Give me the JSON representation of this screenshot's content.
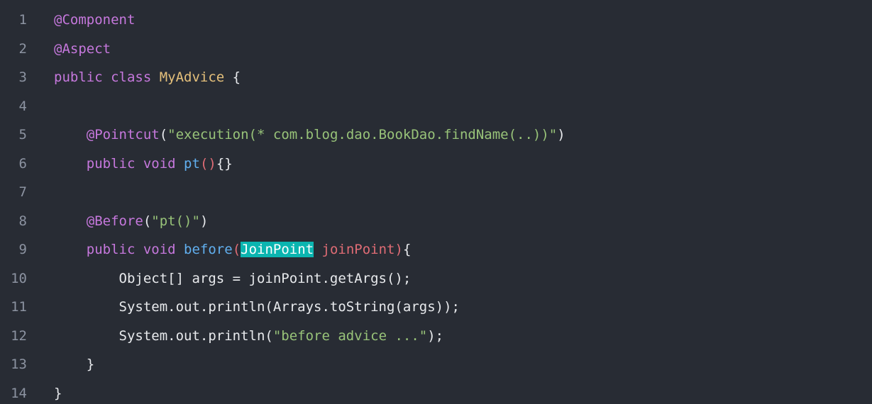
{
  "colors": {
    "background": "#282c34",
    "line_number": "#8c93a1",
    "annotation": "#c678dd",
    "keyword": "#c678dd",
    "class_name": "#e5c07b",
    "plain": "#e8eaed",
    "string": "#98c379",
    "function": "#61afef",
    "param": "#e06c75",
    "highlight_bg": "#0bb5b0"
  },
  "code": {
    "lines": [
      {
        "n": "1",
        "tokens": [
          {
            "t": "@Component",
            "c": "annotation"
          }
        ]
      },
      {
        "n": "2",
        "tokens": [
          {
            "t": "@Aspect",
            "c": "annotation"
          }
        ]
      },
      {
        "n": "3",
        "tokens": [
          {
            "t": "public class ",
            "c": "keyword"
          },
          {
            "t": "MyAdvice",
            "c": "class"
          },
          {
            "t": " {",
            "c": "plain"
          }
        ]
      },
      {
        "n": "4",
        "tokens": []
      },
      {
        "n": "5",
        "tokens": [
          {
            "t": "    ",
            "c": "plain"
          },
          {
            "t": "@Pointcut",
            "c": "annotation"
          },
          {
            "t": "(",
            "c": "plain"
          },
          {
            "t": "\"execution(* com.blog.dao.BookDao.findName(..))\"",
            "c": "string"
          },
          {
            "t": ")",
            "c": "plain"
          }
        ]
      },
      {
        "n": "6",
        "tokens": [
          {
            "t": "    ",
            "c": "plain"
          },
          {
            "t": "public void ",
            "c": "keyword"
          },
          {
            "t": "pt",
            "c": "func"
          },
          {
            "t": "()",
            "c": "param"
          },
          {
            "t": "{}",
            "c": "plain"
          }
        ]
      },
      {
        "n": "7",
        "tokens": []
      },
      {
        "n": "8",
        "tokens": [
          {
            "t": "    ",
            "c": "plain"
          },
          {
            "t": "@Before",
            "c": "annotation"
          },
          {
            "t": "(",
            "c": "plain"
          },
          {
            "t": "\"pt()\"",
            "c": "string"
          },
          {
            "t": ")",
            "c": "plain"
          }
        ]
      },
      {
        "n": "9",
        "tokens": [
          {
            "t": "    ",
            "c": "plain"
          },
          {
            "t": "public void ",
            "c": "keyword"
          },
          {
            "t": "before",
            "c": "func"
          },
          {
            "t": "(",
            "c": "param"
          },
          {
            "t": "JoinPoint",
            "c": "highlight"
          },
          {
            "t": " joinPoint)",
            "c": "param"
          },
          {
            "t": "{",
            "c": "plain"
          }
        ]
      },
      {
        "n": "10",
        "tokens": [
          {
            "t": "        Object[] args = joinPoint.getArgs();",
            "c": "plain"
          }
        ]
      },
      {
        "n": "11",
        "tokens": [
          {
            "t": "        System.out.println(Arrays.toString(args));",
            "c": "plain"
          }
        ]
      },
      {
        "n": "12",
        "tokens": [
          {
            "t": "        System.out.println(",
            "c": "plain"
          },
          {
            "t": "\"before advice ...\"",
            "c": "string"
          },
          {
            "t": ");",
            "c": "plain"
          }
        ]
      },
      {
        "n": "13",
        "tokens": [
          {
            "t": "    }",
            "c": "plain"
          }
        ]
      },
      {
        "n": "14",
        "tokens": [
          {
            "t": "}",
            "c": "plain"
          }
        ]
      }
    ]
  }
}
